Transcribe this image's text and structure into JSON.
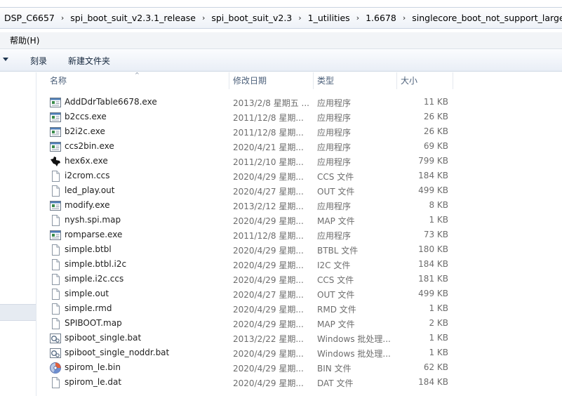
{
  "breadcrumb": [
    "DSP_C6657",
    "spi_boot_suit_v2.3.1_release",
    "spi_boot_suit_v2.3",
    "1_utilities",
    "1.6678",
    "singlecore_boot_not_support_large_binary"
  ],
  "breadcrumb_separator": "›",
  "menu": {
    "help": "帮助(H)"
  },
  "toolbar": {
    "burn": "刻录",
    "new_folder": "新建文件夹"
  },
  "columns": {
    "name": "名称",
    "date": "修改日期",
    "type": "类型",
    "size": "大小"
  },
  "files": [
    {
      "name": "AddDdrTable6678.exe",
      "date": "2013/2/8 星期五 ...",
      "type": "应用程序",
      "size": "11 KB",
      "icon": "exe-icon"
    },
    {
      "name": "b2ccs.exe",
      "date": "2011/12/8 星期...",
      "type": "应用程序",
      "size": "26 KB",
      "icon": "exe-icon"
    },
    {
      "name": "b2i2c.exe",
      "date": "2011/12/8 星期...",
      "type": "应用程序",
      "size": "26 KB",
      "icon": "exe-icon"
    },
    {
      "name": "ccs2bin.exe",
      "date": "2020/4/21 星期...",
      "type": "应用程序",
      "size": "69 KB",
      "icon": "exe-icon"
    },
    {
      "name": "hex6x.exe",
      "date": "2011/2/10 星期...",
      "type": "应用程序",
      "size": "799 KB",
      "icon": "ti-logo-icon"
    },
    {
      "name": "i2crom.ccs",
      "date": "2020/4/29 星期...",
      "type": "CCS 文件",
      "size": "184 KB",
      "icon": "file-icon"
    },
    {
      "name": "led_play.out",
      "date": "2020/4/27 星期...",
      "type": "OUT 文件",
      "size": "499 KB",
      "icon": "file-icon"
    },
    {
      "name": "modify.exe",
      "date": "2013/2/12 星期...",
      "type": "应用程序",
      "size": "8 KB",
      "icon": "exe-icon"
    },
    {
      "name": "nysh.spi.map",
      "date": "2020/4/29 星期...",
      "type": "MAP 文件",
      "size": "1 KB",
      "icon": "file-icon"
    },
    {
      "name": "romparse.exe",
      "date": "2011/12/8 星期...",
      "type": "应用程序",
      "size": "73 KB",
      "icon": "exe-icon"
    },
    {
      "name": "simple.btbl",
      "date": "2020/4/29 星期...",
      "type": "BTBL 文件",
      "size": "180 KB",
      "icon": "file-icon"
    },
    {
      "name": "simple.btbl.i2c",
      "date": "2020/4/29 星期...",
      "type": "I2C 文件",
      "size": "184 KB",
      "icon": "file-icon"
    },
    {
      "name": "simple.i2c.ccs",
      "date": "2020/4/29 星期...",
      "type": "CCS 文件",
      "size": "181 KB",
      "icon": "file-icon"
    },
    {
      "name": "simple.out",
      "date": "2020/4/27 星期...",
      "type": "OUT 文件",
      "size": "499 KB",
      "icon": "file-icon"
    },
    {
      "name": "simple.rmd",
      "date": "2020/4/29 星期...",
      "type": "RMD 文件",
      "size": "1 KB",
      "icon": "file-icon"
    },
    {
      "name": "SPIBOOT.map",
      "date": "2020/4/29 星期...",
      "type": "MAP 文件",
      "size": "2 KB",
      "icon": "file-icon"
    },
    {
      "name": "spiboot_single.bat",
      "date": "2013/2/22 星期...",
      "type": "Windows 批处理...",
      "size": "1 KB",
      "icon": "bat-icon"
    },
    {
      "name": "spiboot_single_noddr.bat",
      "date": "2020/4/29 星期...",
      "type": "Windows 批处理...",
      "size": "1 KB",
      "icon": "bat-icon"
    },
    {
      "name": "spirom_le.bin",
      "date": "2020/4/29 星期...",
      "type": "BIN 文件",
      "size": "62 KB",
      "icon": "bin-icon"
    },
    {
      "name": "spirom_le.dat",
      "date": "2020/4/29 星期...",
      "type": "DAT 文件",
      "size": "184 KB",
      "icon": "file-icon"
    }
  ]
}
